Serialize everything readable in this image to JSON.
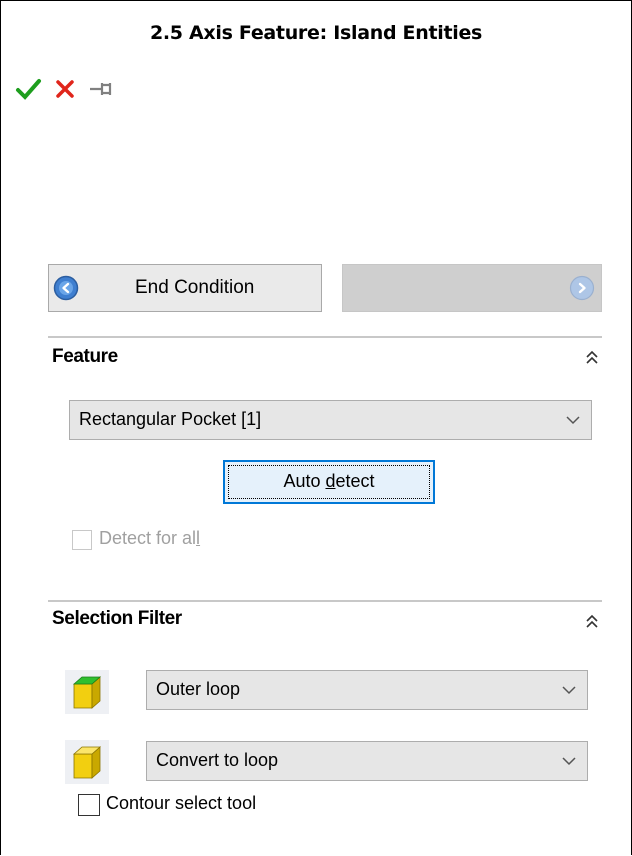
{
  "panel": {
    "title": "2.5 Axis Feature: Island Entities"
  },
  "toolbar": {
    "ok_icon": "check-icon",
    "cancel_icon": "close-icon",
    "pin_icon": "pin-icon",
    "colors": {
      "ok": "#1e9e1e",
      "cancel": "#e0251b",
      "pin": "#808080"
    }
  },
  "navigation": {
    "back_label": "End Condition",
    "back_icon": "arrow-left-circle-icon",
    "next_label": "",
    "next_icon": "arrow-right-circle-icon"
  },
  "feature": {
    "header": "Feature",
    "dropdown_value": "Rectangular Pocket [1]",
    "auto_detect_label": "Auto detect",
    "auto_detect_mnemonic": "d",
    "detect_for_all_label": "Detect for all",
    "detect_for_all_mnemonic": "l",
    "detect_for_all_checked": false,
    "detect_for_all_enabled": false
  },
  "selection_filter": {
    "header": "Selection Filter",
    "loop_type_value": "Outer loop",
    "loop_type_icon": "cube-green-top-icon",
    "convert_value": "Convert to loop",
    "convert_icon": "cube-yellow-icon",
    "contour_tool_label": "Contour select tool",
    "contour_tool_checked": false
  },
  "colors": {
    "accent_focus": "#0078d7",
    "cube_yellow": "#e8c400",
    "cube_green": "#2fbf2f"
  }
}
